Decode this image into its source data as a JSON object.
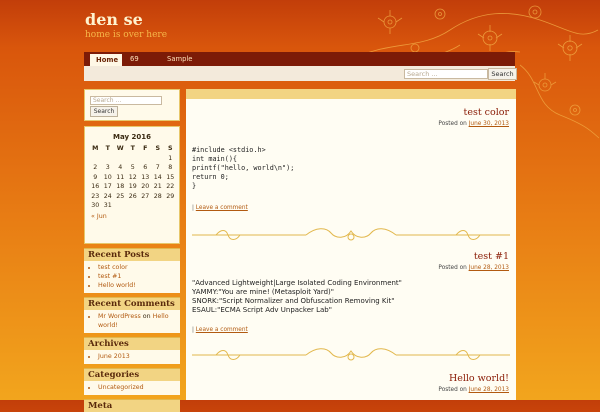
{
  "site": {
    "title": "den se",
    "tagline": "home is over here"
  },
  "nav": {
    "items": [
      {
        "label": "Home",
        "active": true
      },
      {
        "label": "69 rules",
        "active": false
      },
      {
        "label": "Sample Page",
        "active": false
      }
    ]
  },
  "top_search": {
    "placeholder": "Search ...",
    "button_label": "Search"
  },
  "sidebar": {
    "search": {
      "placeholder": "Search ...",
      "button_label": "Search"
    },
    "calendar": {
      "title": "May 2016",
      "days": [
        "M",
        "T",
        "W",
        "T",
        "F",
        "S",
        "S"
      ],
      "weeks": [
        [
          "",
          "",
          "",
          "",
          "",
          "",
          "1"
        ],
        [
          "2",
          "3",
          "4",
          "5",
          "6",
          "7",
          "8"
        ],
        [
          "9",
          "10",
          "11",
          "12",
          "13",
          "14",
          "15"
        ],
        [
          "16",
          "17",
          "18",
          "19",
          "20",
          "21",
          "22"
        ],
        [
          "23",
          "24",
          "25",
          "26",
          "27",
          "28",
          "29"
        ],
        [
          "30",
          "31",
          "",
          "",
          "",
          "",
          ""
        ]
      ],
      "prev_link": "« Jun"
    },
    "recent_posts": {
      "title": "Recent Posts",
      "items": [
        "test color",
        "test #1",
        "Hello world!"
      ]
    },
    "recent_comments": {
      "title": "Recent Comments",
      "items": [
        {
          "author": "Mr WordPress",
          "on": "on",
          "post": "Hello world!"
        }
      ]
    },
    "archives": {
      "title": "Archives",
      "items": [
        "June 2013"
      ]
    },
    "categories": {
      "title": "Categories",
      "items": [
        "Uncategorized"
      ]
    },
    "meta": {
      "title": "Meta"
    }
  },
  "posts": [
    {
      "title": "test color",
      "posted_on": "Posted on",
      "date": "June 30, 2013",
      "body": "#include <stdio.h>\nint main(){\nprintf(\"hello, world\\n\");\nreturn 0;\n}",
      "comment_prefix": "|",
      "comment_link": "Leave a comment"
    },
    {
      "title": "test #1",
      "posted_on": "Posted on",
      "date": "June 28, 2013",
      "body": "\"Advanced Lightweight|Large Isolated Coding Environment\"\nYAMMY:\"You are mine! (Metasploit Yard)\"\nSNORK:\"Script Normalizer and Obfuscation Removing Kit\"\nESAUL:\"ECMA Script Adv Unpacker Lab\"",
      "comment_prefix": "|",
      "comment_link": "Leave a comment"
    },
    {
      "title": "Hello world!",
      "posted_on": "Posted on",
      "date": "June 28, 2013"
    }
  ]
}
